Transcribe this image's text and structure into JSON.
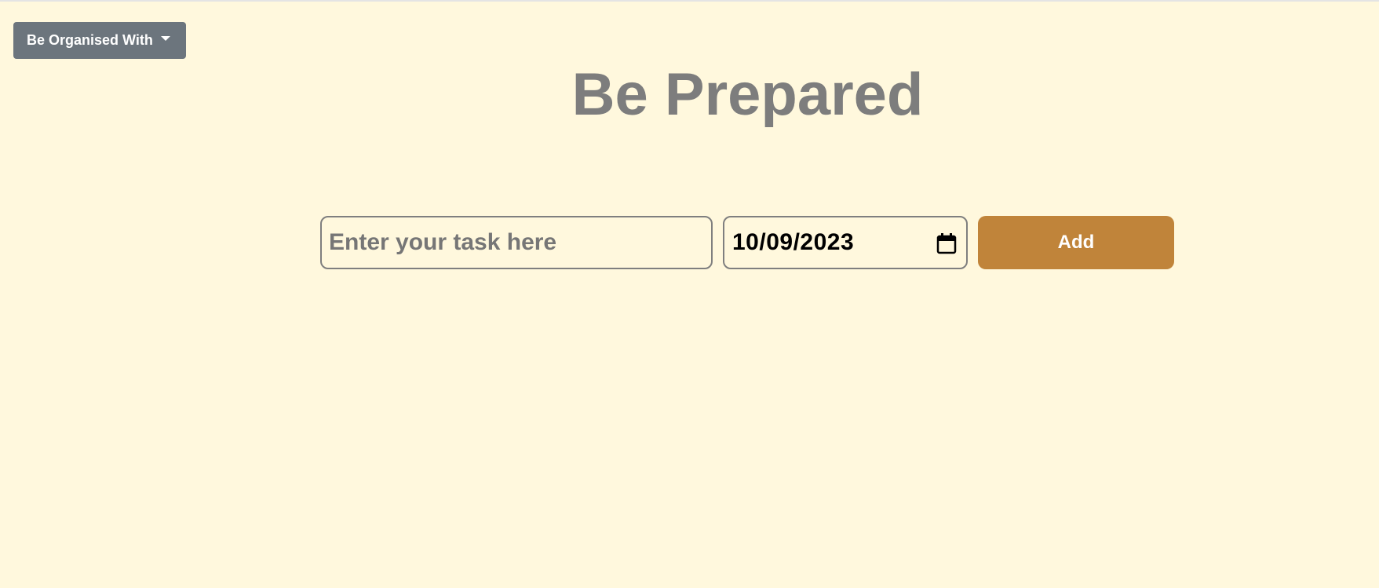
{
  "header": {
    "dropdown_label": "Be Organised With"
  },
  "main": {
    "title": "Be Prepared",
    "task_input": {
      "placeholder": "Enter your task here",
      "value": ""
    },
    "date_input": {
      "value": "10/09/2023"
    },
    "add_button_label": "Add"
  },
  "colors": {
    "background": "#fff8dd",
    "dropdown_bg": "#6c757d",
    "title_color": "#7d7d7d",
    "add_button_bg": "#c0843a",
    "input_border": "#7f7f7f"
  },
  "icons": {
    "dropdown_caret": "chevron-down-icon",
    "date_picker": "calendar-icon"
  }
}
